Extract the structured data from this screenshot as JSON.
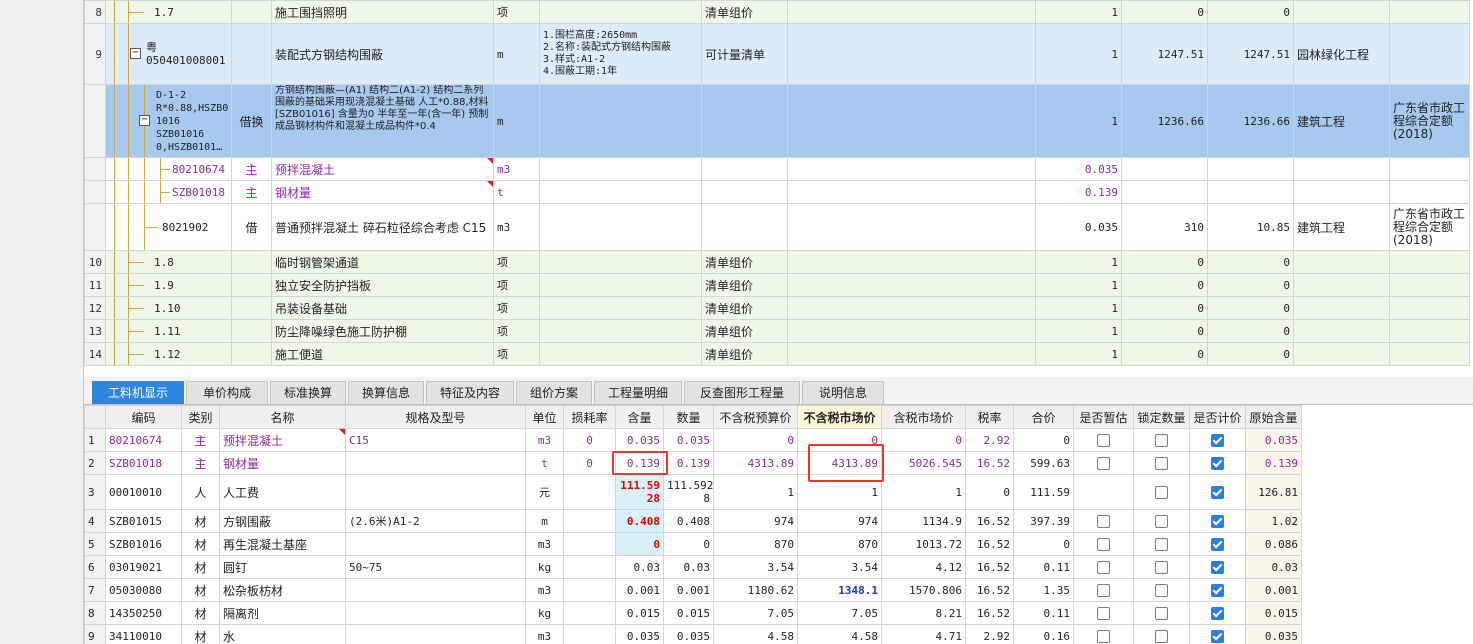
{
  "top_rows": [
    {
      "n": "8",
      "code": "1.7",
      "cat": "",
      "name": "施工围挡照明",
      "unit": "项",
      "feature": "",
      "type": "清单组价",
      "qty": "1",
      "price": "0",
      "total": "0",
      "prof": "",
      "lib": "",
      "style": "green"
    },
    {
      "n": "9",
      "code1": "粤",
      "code2": "050401008001",
      "cat": "",
      "name": "装配式方钢结构围蔽",
      "unit": "m",
      "feature": "1.围栏高度:2650mm\n2.名称:装配式方钢结构围蔽\n3.样式:A1-2\n4.围蔽工期:1年",
      "type": "可计量清单",
      "qty": "1",
      "price": "1247.51",
      "total": "1247.51",
      "prof": "园林绿化工程",
      "lib": "",
      "style": "blue"
    },
    {
      "n": "",
      "code": "D-1-2\nR*0.88,HSZB0\n1016\nSZB01016\n0,HSZB0101…",
      "cat": "借换",
      "name": "方钢结构围蔽—(A1) 结构二(A1-2)  结构二系列围蔽的基础采用现浇混凝土基础  人工*0.88,材料[SZB01016] 含量为0  半年至一年(含一年) 预制成品钢材构件和混凝土成品构件*0.4",
      "unit": "m",
      "feature": "",
      "type": "",
      "qty": "1",
      "price": "1236.66",
      "total": "1236.66",
      "prof": "建筑工程",
      "lib": "广东省市政工程综合定额(2018)",
      "style": "sel"
    },
    {
      "n": "",
      "code": "80210674",
      "cat": "主",
      "name": "预拌混凝土",
      "unit": "m3",
      "feature": "",
      "type": "",
      "qty": "0.035",
      "price": "",
      "total": "",
      "prof": "",
      "lib": "",
      "style": "white",
      "purple": true
    },
    {
      "n": "",
      "code": "SZB01018",
      "cat": "主",
      "name": "钢材量",
      "unit": "t",
      "feature": "",
      "type": "",
      "qty": "0.139",
      "price": "",
      "total": "",
      "prof": "",
      "lib": "",
      "style": "white",
      "purple": true
    },
    {
      "n": "",
      "code": "8021902",
      "cat": "借",
      "name": "普通预拌混凝土 碎石粒径综合考虑 C15",
      "unit": "m3",
      "feature": "",
      "type": "",
      "qty": "0.035",
      "price": "310",
      "total": "10.85",
      "prof": "建筑工程",
      "lib": "广东省市政工程综合定额(2018)",
      "style": "white"
    },
    {
      "n": "10",
      "code": "1.8",
      "cat": "",
      "name": "临时钢管架通道",
      "unit": "项",
      "feature": "",
      "type": "清单组价",
      "qty": "1",
      "price": "0",
      "total": "0",
      "prof": "",
      "lib": "",
      "style": "green"
    },
    {
      "n": "11",
      "code": "1.9",
      "cat": "",
      "name": "独立安全防护挡板",
      "unit": "项",
      "feature": "",
      "type": "清单组价",
      "qty": "1",
      "price": "0",
      "total": "0",
      "prof": "",
      "lib": "",
      "style": "green"
    },
    {
      "n": "12",
      "code": "1.10",
      "cat": "",
      "name": "吊装设备基础",
      "unit": "项",
      "feature": "",
      "type": "清单组价",
      "qty": "1",
      "price": "0",
      "total": "0",
      "prof": "",
      "lib": "",
      "style": "green"
    },
    {
      "n": "13",
      "code": "1.11",
      "cat": "",
      "name": "防尘降噪绿色施工防护棚",
      "unit": "项",
      "feature": "",
      "type": "清单组价",
      "qty": "1",
      "price": "0",
      "total": "0",
      "prof": "",
      "lib": "",
      "style": "green"
    },
    {
      "n": "14",
      "code": "1.12",
      "cat": "",
      "name": "施工便道",
      "unit": "项",
      "feature": "",
      "type": "清单组价",
      "qty": "1",
      "price": "0",
      "total": "0",
      "prof": "",
      "lib": "",
      "style": "green"
    }
  ],
  "tabs": [
    "工料机显示",
    "单价构成",
    "标准换算",
    "换算信息",
    "特征及内容",
    "组价方案",
    "工程量明细",
    "反查图形工程量",
    "说明信息"
  ],
  "headers": [
    "编码",
    "类别",
    "名称",
    "规格及型号",
    "单位",
    "损耗率",
    "含量",
    "数量",
    "不含税预算价",
    "不含税市场价",
    "含税市场价",
    "税率",
    "合价",
    "是否暂估",
    "锁定数量",
    "是否计价",
    "原始含量"
  ],
  "rows": [
    {
      "n": "1",
      "code": "80210674",
      "cat": "主",
      "name": "预拌混凝土",
      "spec": "C15",
      "unit": "m3",
      "loss": "0",
      "content": "0.035",
      "qty": "0.035",
      "budget": "0",
      "market": "0",
      "taxmarket": "0",
      "tax": "2.92",
      "total": "0",
      "zg": false,
      "lock": false,
      "jj": true,
      "orig": "0.035",
      "purple": true
    },
    {
      "n": "2",
      "code": "SZB01018",
      "cat": "主",
      "name": "钢材量",
      "spec": "",
      "unit": "t",
      "loss": "0",
      "content": "0.139",
      "qty": "0.139",
      "budget": "4313.89",
      "market": "4313.89",
      "taxmarket": "5026.545",
      "tax": "16.52",
      "total": "599.63",
      "zg": false,
      "lock": false,
      "jj": true,
      "orig": "0.139",
      "purple": true
    },
    {
      "n": "3",
      "code": "00010010",
      "cat": "人",
      "name": "人工费",
      "spec": "",
      "unit": "元",
      "loss": "",
      "content": "111.59\n28",
      "qty": "111.592\n8",
      "budget": "1",
      "market": "1",
      "taxmarket": "1",
      "tax": "0",
      "total": "111.59",
      "zg": null,
      "lock": false,
      "jj": true,
      "orig": "126.81"
    },
    {
      "n": "4",
      "code": "SZB01015",
      "cat": "材",
      "name": "方钢围蔽",
      "spec": "(2.6米)A1-2",
      "unit": "m",
      "loss": "",
      "content": "0.408",
      "qty": "0.408",
      "budget": "974",
      "market": "974",
      "taxmarket": "1134.9",
      "tax": "16.52",
      "total": "397.39",
      "zg": false,
      "lock": false,
      "jj": true,
      "orig": "1.02"
    },
    {
      "n": "5",
      "code": "SZB01016",
      "cat": "材",
      "name": "再生混凝土基座",
      "spec": "",
      "unit": "m3",
      "loss": "",
      "content": "0",
      "qty": "0",
      "budget": "870",
      "market": "870",
      "taxmarket": "1013.72",
      "tax": "16.52",
      "total": "0",
      "zg": false,
      "lock": false,
      "jj": true,
      "orig": "0.086"
    },
    {
      "n": "6",
      "code": "03019021",
      "cat": "材",
      "name": "圆钉",
      "spec": "50~75",
      "unit": "kg",
      "loss": "",
      "content": "0.03",
      "qty": "0.03",
      "budget": "3.54",
      "market": "3.54",
      "taxmarket": "4.12",
      "tax": "16.52",
      "total": "0.11",
      "zg": false,
      "lock": false,
      "jj": true,
      "orig": "0.03"
    },
    {
      "n": "7",
      "code": "05030080",
      "cat": "材",
      "name": "松杂板枋材",
      "spec": "",
      "unit": "m3",
      "loss": "",
      "content": "0.001",
      "qty": "0.001",
      "budget": "1180.62",
      "market": "1348.1",
      "taxmarket": "1570.806",
      "tax": "16.52",
      "total": "1.35",
      "zg": false,
      "lock": false,
      "jj": true,
      "orig": "0.001",
      "market_blue": true
    },
    {
      "n": "8",
      "code": "14350250",
      "cat": "材",
      "name": "隔离剂",
      "spec": "",
      "unit": "kg",
      "loss": "",
      "content": "0.015",
      "qty": "0.015",
      "budget": "7.05",
      "market": "7.05",
      "taxmarket": "8.21",
      "tax": "16.52",
      "total": "0.11",
      "zg": false,
      "lock": false,
      "jj": true,
      "orig": "0.015"
    },
    {
      "n": "9",
      "code": "34110010",
      "cat": "材",
      "name": "水",
      "spec": "",
      "unit": "m3",
      "loss": "",
      "content": "0.035",
      "qty": "0.035",
      "budget": "4.58",
      "market": "4.58",
      "taxmarket": "4.71",
      "tax": "2.92",
      "total": "0.16",
      "zg": false,
      "lock": false,
      "jj": true,
      "orig": "0.035"
    }
  ],
  "colors": {
    "accent": "#2f86dd",
    "selected_row": "#a7c9ee",
    "bill_row": "#ddebfb",
    "measure_row": "#eef8e9",
    "highlight": "#e53a2f"
  }
}
